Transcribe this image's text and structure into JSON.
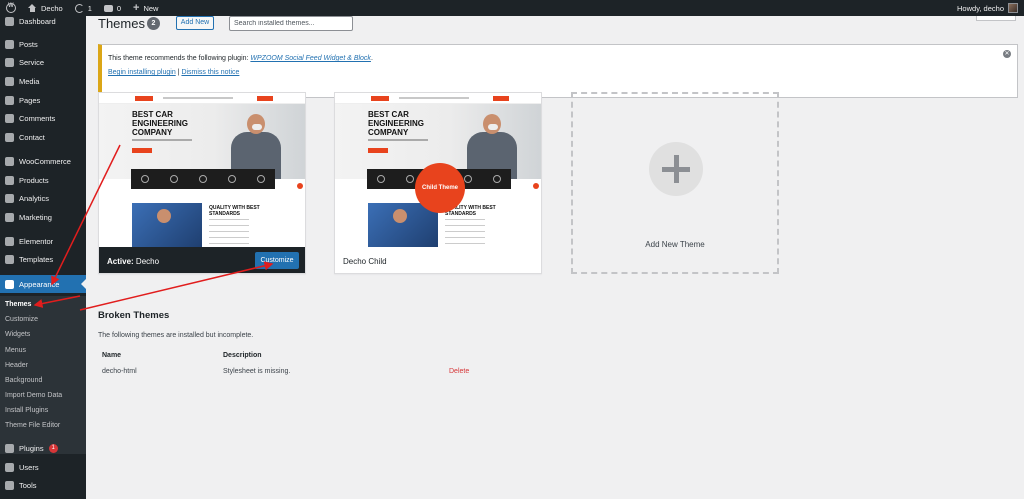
{
  "adminbar": {
    "site_name": "Decho",
    "updates_count": "1",
    "comments_count": "0",
    "new_label": "New",
    "howdy": "Howdy, decho"
  },
  "sidebar": {
    "items": [
      {
        "label": "Dashboard",
        "icon": "dashboard-icon"
      },
      {
        "label": "Posts",
        "icon": "pin-icon"
      },
      {
        "label": "Service",
        "icon": "gear-icon"
      },
      {
        "label": "Media",
        "icon": "media-icon"
      },
      {
        "label": "Pages",
        "icon": "pages-icon"
      },
      {
        "label": "Comments",
        "icon": "comment-icon"
      },
      {
        "label": "Contact",
        "icon": "mail-icon"
      },
      {
        "label": "WooCommerce",
        "icon": "woocommerce-icon"
      },
      {
        "label": "Products",
        "icon": "archive-icon"
      },
      {
        "label": "Analytics",
        "icon": "chart-icon"
      },
      {
        "label": "Marketing",
        "icon": "megaphone-icon"
      },
      {
        "label": "Elementor",
        "icon": "elementor-icon"
      },
      {
        "label": "Templates",
        "icon": "folder-icon"
      },
      {
        "label": "Appearance",
        "icon": "brush-icon"
      },
      {
        "label": "Plugins",
        "icon": "plugin-icon",
        "badge": "1"
      },
      {
        "label": "Users",
        "icon": "user-icon"
      },
      {
        "label": "Tools",
        "icon": "wrench-icon"
      }
    ],
    "submenu": [
      "Themes",
      "Customize",
      "Widgets",
      "Menus",
      "Header",
      "Background",
      "Import Demo Data",
      "Install Plugins",
      "Theme File Editor"
    ]
  },
  "header": {
    "title": "Themes",
    "count": "2",
    "add_new": "Add New",
    "search_placeholder": "Search installed themes..."
  },
  "notice": {
    "text_before": "This theme recommends the following plugin: ",
    "plugin_link": "WPZOOM Social Feed Widget & Block",
    "text_after": ".",
    "install_link": "Begin installing plugin",
    "separator": " | ",
    "dismiss_link": "Dismiss this notice"
  },
  "themes": [
    {
      "active_prefix": "Active:",
      "name": "Decho",
      "customize": "Customize",
      "hero_title_1": "BEST CAR",
      "hero_title_2": "ENGINEERING",
      "hero_title_3": "COMPANY",
      "quality_1": "QUALITY WITH BEST",
      "quality_2": "STANDARDS"
    },
    {
      "name": "Decho Child",
      "badge": "Child Theme",
      "hero_title_1": "BEST CAR",
      "hero_title_2": "ENGINEERING",
      "hero_title_3": "COMPANY",
      "quality_1": "QUALITY WITH BEST",
      "quality_2": "STANDARDS"
    }
  ],
  "add_new_theme": "Add New Theme",
  "broken": {
    "title": "Broken Themes",
    "description": "The following themes are installed but incomplete.",
    "col_name": "Name",
    "col_description": "Description",
    "rows": [
      {
        "name": "decho-html",
        "description": "Stylesheet is missing.",
        "action": "Delete"
      }
    ]
  },
  "colors": {
    "admin_dark": "#1d2327",
    "accent_blue": "#2271b1",
    "notice_warning": "#dba617",
    "brand_orange": "#e8431d",
    "annotation_red": "#e11d1d",
    "delete_red": "#d63638"
  }
}
